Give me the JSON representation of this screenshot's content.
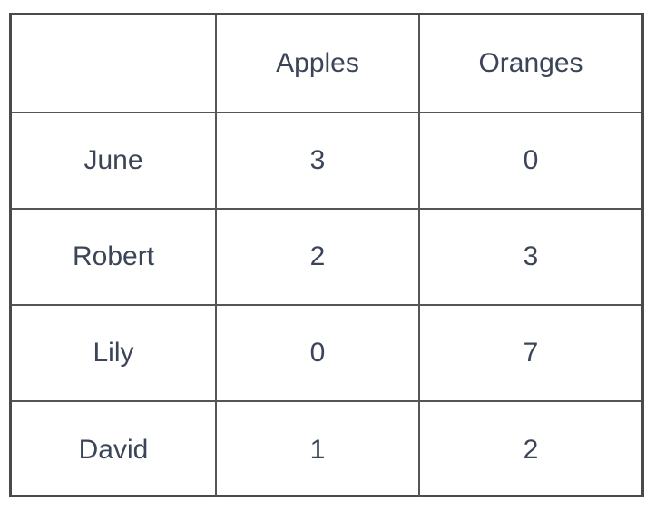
{
  "table": {
    "corner": "",
    "columns": [
      "Apples",
      "Oranges"
    ],
    "rows": [
      {
        "name": "June",
        "apples": "3",
        "oranges": "0"
      },
      {
        "name": "Robert",
        "apples": "2",
        "oranges": "3"
      },
      {
        "name": "Lily",
        "apples": "0",
        "oranges": "7"
      },
      {
        "name": "David",
        "apples": "1",
        "oranges": "2"
      }
    ]
  }
}
